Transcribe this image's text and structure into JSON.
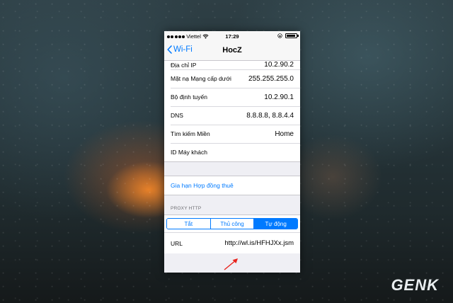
{
  "status_bar": {
    "carrier": "Viettel",
    "time": "17:29"
  },
  "nav": {
    "back_label": "Wi-Fi",
    "title": "HocZ"
  },
  "info_rows": [
    {
      "label": "Địa chỉ IP",
      "value": "10.2.90.2"
    },
    {
      "label": "Mặt nạ Mạng cấp dưới",
      "value": "255.255.255.0"
    },
    {
      "label": "Bộ định tuyến",
      "value": "10.2.90.1"
    },
    {
      "label": "DNS",
      "value": "8.8.8.8, 8.8.4.4"
    },
    {
      "label": "Tìm kiếm Miền",
      "value": "Home"
    },
    {
      "label": "ID Máy khách",
      "value": ""
    }
  ],
  "renew_lease": "Gia hạn Hợp đồng thuê",
  "proxy": {
    "header": "PROXY HTTP",
    "options": [
      "Tắt",
      "Thủ công",
      "Tự động"
    ],
    "selected": "Tự động",
    "url_label": "URL",
    "url_value": "http://wl.is/HFHJXx.jsm"
  },
  "watermark": "GENK",
  "colors": {
    "accent": "#007aff",
    "group_bg": "#efeff4",
    "arrow": "#e8231c"
  }
}
